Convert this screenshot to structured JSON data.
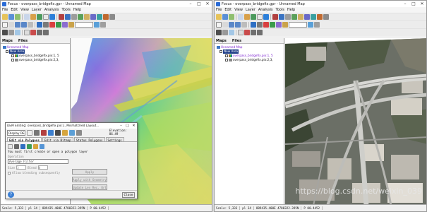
{
  "left": {
    "title": "Focus - overpass_bridgefix.gpr - Unnamed Map",
    "menu": [
      "File",
      "Edit",
      "View",
      "Layer",
      "Analysis",
      "Tools",
      "Help"
    ],
    "panel_tabs": [
      "Maps",
      "Files"
    ],
    "tree": {
      "map": "Unnamed Map",
      "area": "New Area",
      "layer1": "overpass_bridgefix.pix:1, 5",
      "layer2": "overpass_bridgefix.pix:2,3,"
    },
    "status": {
      "scale": "Scale: 5,333",
      "coord": "pl 34",
      "utm": "889435.400E 4780322.395N",
      "pix": "P 00.4452"
    }
  },
  "right": {
    "title": "Focus - overpass_bridgefix.gpr - Unnamed Map",
    "menu": [
      "File",
      "Edit",
      "View",
      "Layer",
      "Analysis",
      "Tools",
      "Help"
    ],
    "panel_tabs": [
      "Maps",
      "Files"
    ],
    "tree": {
      "map": "Unnamed Map",
      "area": "New Area",
      "layer1": "overpass_bridgefix.pix:1, 5",
      "layer2": "overpass_bridgefix.pix:2,3,"
    },
    "status": {
      "scale": "Scale: 5,333",
      "coord": "pl 34",
      "utm": "889435.400E 4780322.395N",
      "pix": "P 00.4452"
    }
  },
  "dialog": {
    "title": "DEM Editing: overpass_bridgefix.pix:1, Mismatched Layout...",
    "display_label": "Display DEM",
    "elevation_label": "Elevation:",
    "elevation_value": "86.49",
    "tabs": [
      "Edit via Polygons",
      "Edit via Bitmap",
      "Status Polygons",
      "Settings"
    ],
    "hint": "You must first create or open a polygon layer",
    "operation_label": "Operation",
    "filter": "Average Filter",
    "size_label": "Size",
    "size_value": "3",
    "blend_label": "Blend",
    "blend_value": "0",
    "allow_label": "Allow blending subsequently",
    "apply": "Apply",
    "apply_geometry": "Apply with Geometry",
    "update_btn": "Update Lev Rec. Orth.",
    "close": "Close"
  },
  "watermark": "https://blog.csdn.net/weixin_039"
}
